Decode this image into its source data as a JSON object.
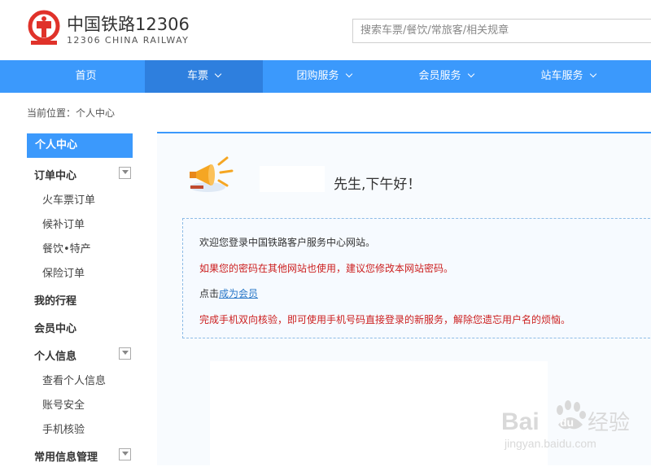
{
  "header": {
    "logo_cn": "中国铁路12306",
    "logo_en": "12306 CHINA RAILWAY",
    "search_placeholder": "搜索车票/餐饮/常旅客/相关规章"
  },
  "nav": [
    {
      "label": "首页",
      "dropdown": false,
      "active": false
    },
    {
      "label": "车票",
      "dropdown": true,
      "active": true
    },
    {
      "label": "团购服务",
      "dropdown": true,
      "active": false
    },
    {
      "label": "会员服务",
      "dropdown": true,
      "active": false
    },
    {
      "label": "站车服务",
      "dropdown": true,
      "active": false
    }
  ],
  "breadcrumb": "当前位置：个人中心",
  "sidebar": {
    "title": "个人中心",
    "order_center": "订单中心",
    "order_items": [
      "火车票订单",
      "候补订单",
      "餐饮•特产",
      "保险订单"
    ],
    "my_trips": "我的行程",
    "member_center": "会员中心",
    "personal_info": "个人信息",
    "personal_items": [
      "查看个人信息",
      "账号安全",
      "手机核验"
    ],
    "common_info": "常用信息管理"
  },
  "main": {
    "greeting": "先生,下午好！",
    "line1": "欢迎您登录中国铁路客户服务中心网站。",
    "line2": "如果您的密码在其他网站也使用，建议您修改本网站密码。",
    "line3_prefix": "点击",
    "line3_link": "成为会员",
    "line4": "完成手机双向核验，即可使用手机号码直接登录的新服务，解除您遗忘用户名的烦恼。"
  },
  "watermark": {
    "brand": "Bai",
    "brand2": "du",
    "cn": "经验",
    "url": "jingyan.baidu.com"
  },
  "colors": {
    "brand_blue": "#3b99fc",
    "nav_active": "#2e7fde",
    "logo_red": "#e0322a",
    "alert_red": "#cc1f1f",
    "link_blue": "#2a78c8"
  }
}
